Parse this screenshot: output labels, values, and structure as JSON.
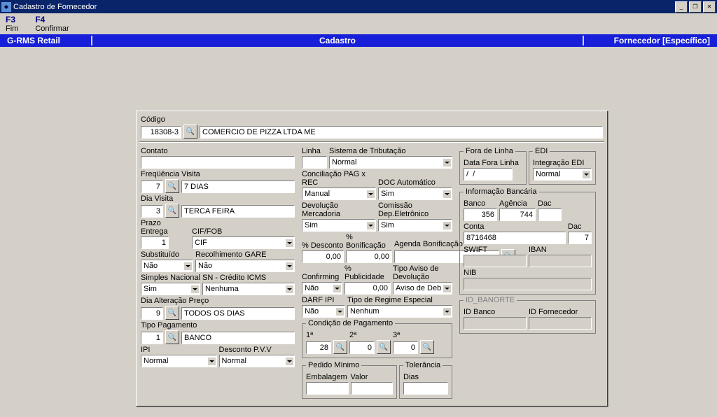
{
  "window": {
    "title": "Cadastro de Fornecedor"
  },
  "menu": {
    "f3k": "F3",
    "f3l": "Fim",
    "f4k": "F4",
    "f4l": "Confirmar"
  },
  "bar": {
    "left": "G-RMS Retail",
    "mid": "Cadastro",
    "right": "Fornecedor [Específico]"
  },
  "k": {
    "codigo_l": "Código",
    "codigo": "18308-3",
    "nome": "COMERCIO DE PIZZA LTDA ME",
    "contato_l": "Contato",
    "contato": "",
    "freq_l": "Freqüência Visita",
    "freq_n": "7",
    "freq_d": "7 DIAS",
    "diav_l": "Dia Visita",
    "diav_n": "3",
    "diav_d": "TERCA FEIRA",
    "prazo_l": "Prazo Entrega",
    "prazo": "1",
    "ciffob_l": "CIF/FOB",
    "ciffob": "CIF",
    "subst_l": "Substituído",
    "subst": "Não",
    "gare_l": "Recolhimento GARE",
    "gare": "Não",
    "simples_l": "Simples Nacional",
    "simples": "Sim",
    "snci_l": "SN - Crédito ICMS",
    "snci": "Nenhuma",
    "diaalt_l": "Dia Alteração Preço",
    "diaalt_n": "9",
    "diaalt_d": "TODOS OS DIAS",
    "tipopg_l": "Tipo Pagamento",
    "tipopg_n": "1",
    "tipopg_d": "BANCO",
    "ipi_l": "IPI",
    "ipi": "Normal",
    "descpvv_l": "Desconto P.V.V",
    "descpvv": "Normal",
    "linha_l": "Linha",
    "linha": "",
    "sist_l": "Sistema de Tributação",
    "sist": "Normal",
    "conc_l": "Conciliação PAG x REC",
    "conc": "Manual",
    "doca_l": "DOC Automático",
    "doca": "Sim",
    "devm_l": "Devolução Mercadoria",
    "devm": "Sim",
    "comd_l": "Comissão Dep.Eletrônico",
    "comd": "Sim",
    "pdesc_l": "% Desconto",
    "pdesc": "0,00",
    "pbon_l": "% Bonificação",
    "pbon": "0,00",
    "agb_l": "Agenda Bonificação",
    "agb": "",
    "conf_l": "Confirming",
    "conf": "Não",
    "ppub_l": "% Publicidade",
    "ppub": "0,00",
    "tipoav_l": "Tipo Aviso de Devolução",
    "tipoav": "Aviso de Debito",
    "darf_l": "DARF IPI",
    "darf": "Não",
    "treg_l": "Tipo de Regime Especial",
    "treg": "Nenhum",
    "cond_l": "Condição de Pagamento",
    "c1l": "1ª",
    "c2l": "2ª",
    "c3l": "3ª",
    "c1": "28",
    "c2": "0",
    "c3": "0",
    "pmin_l": "Pedido Mínimo",
    "emb_l": "Embalagem",
    "val_l": "Valor",
    "emb": "",
    "val": "",
    "tol_l": "Tolerância",
    "dias_l": "Dias",
    "dias": "",
    "fora_l": "Fora de Linha",
    "fora_d_l": "Data Fora Linha",
    "fora_d": "/  /",
    "edi_l": "EDI",
    "edi_i_l": "Integração EDI",
    "edi": "Normal",
    "ib_l": "Informação Bancária",
    "banco_l": "Banco",
    "banco": "356",
    "ag_l": "Agência",
    "ag": "744",
    "dac_l": "Dac",
    "dac1": "",
    "conta_l": "Conta",
    "conta": "8716468",
    "dac2": "7",
    "swift_l": "SWIFT",
    "swift": "",
    "iban_l": "IBAN",
    "iban": "",
    "nib_l": "NIB",
    "nib": "",
    "idb_grp": "ID_BANORTE",
    "idb_l": "ID Banco",
    "idb": "",
    "idf_l": "ID Fornecedor",
    "idf": ""
  }
}
